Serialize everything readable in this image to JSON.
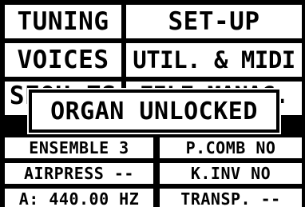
{
  "menu": {
    "tuning": "TUNING",
    "setup": "SET-UP",
    "voices": "VOICES",
    "util_midi": "UTIL. & MIDI",
    "row3_left": "SEQU.ZS",
    "row3_right": "FILE MANAG."
  },
  "popup": {
    "message": "ORGAN UNLOCKED"
  },
  "status": {
    "ensemble": "ENSEMBLE 3",
    "pcomb": "P.COMB NO",
    "airpress": "AIRPRESS --",
    "kinv": "K.INV NO",
    "pitch": "A: 440.00 HZ",
    "transp": "TRANSP. --"
  }
}
